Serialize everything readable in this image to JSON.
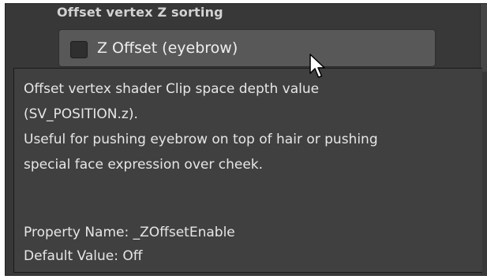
{
  "section": {
    "header": "Offset vertex Z sorting"
  },
  "toggle": {
    "label": "Z Offset (eyebrow)",
    "checked": false
  },
  "tooltip": {
    "description_lines": [
      "Offset vertex shader Clip space depth value",
      "(SV_POSITION.z).",
      "Useful for pushing eyebrow on top of hair or pushing",
      "special face expression over cheek."
    ],
    "property_name": "Property Name: _ZOffsetEnable",
    "default_value": "Default Value: Off"
  },
  "icons": {
    "checkbox": "checkbox-unchecked-icon",
    "cursor": "mouse-pointer-icon"
  },
  "colors": {
    "panel_bg": "#383838",
    "button_bg": "#585858",
    "tooltip_bg": "#404040",
    "text": "#e6e6e6"
  }
}
